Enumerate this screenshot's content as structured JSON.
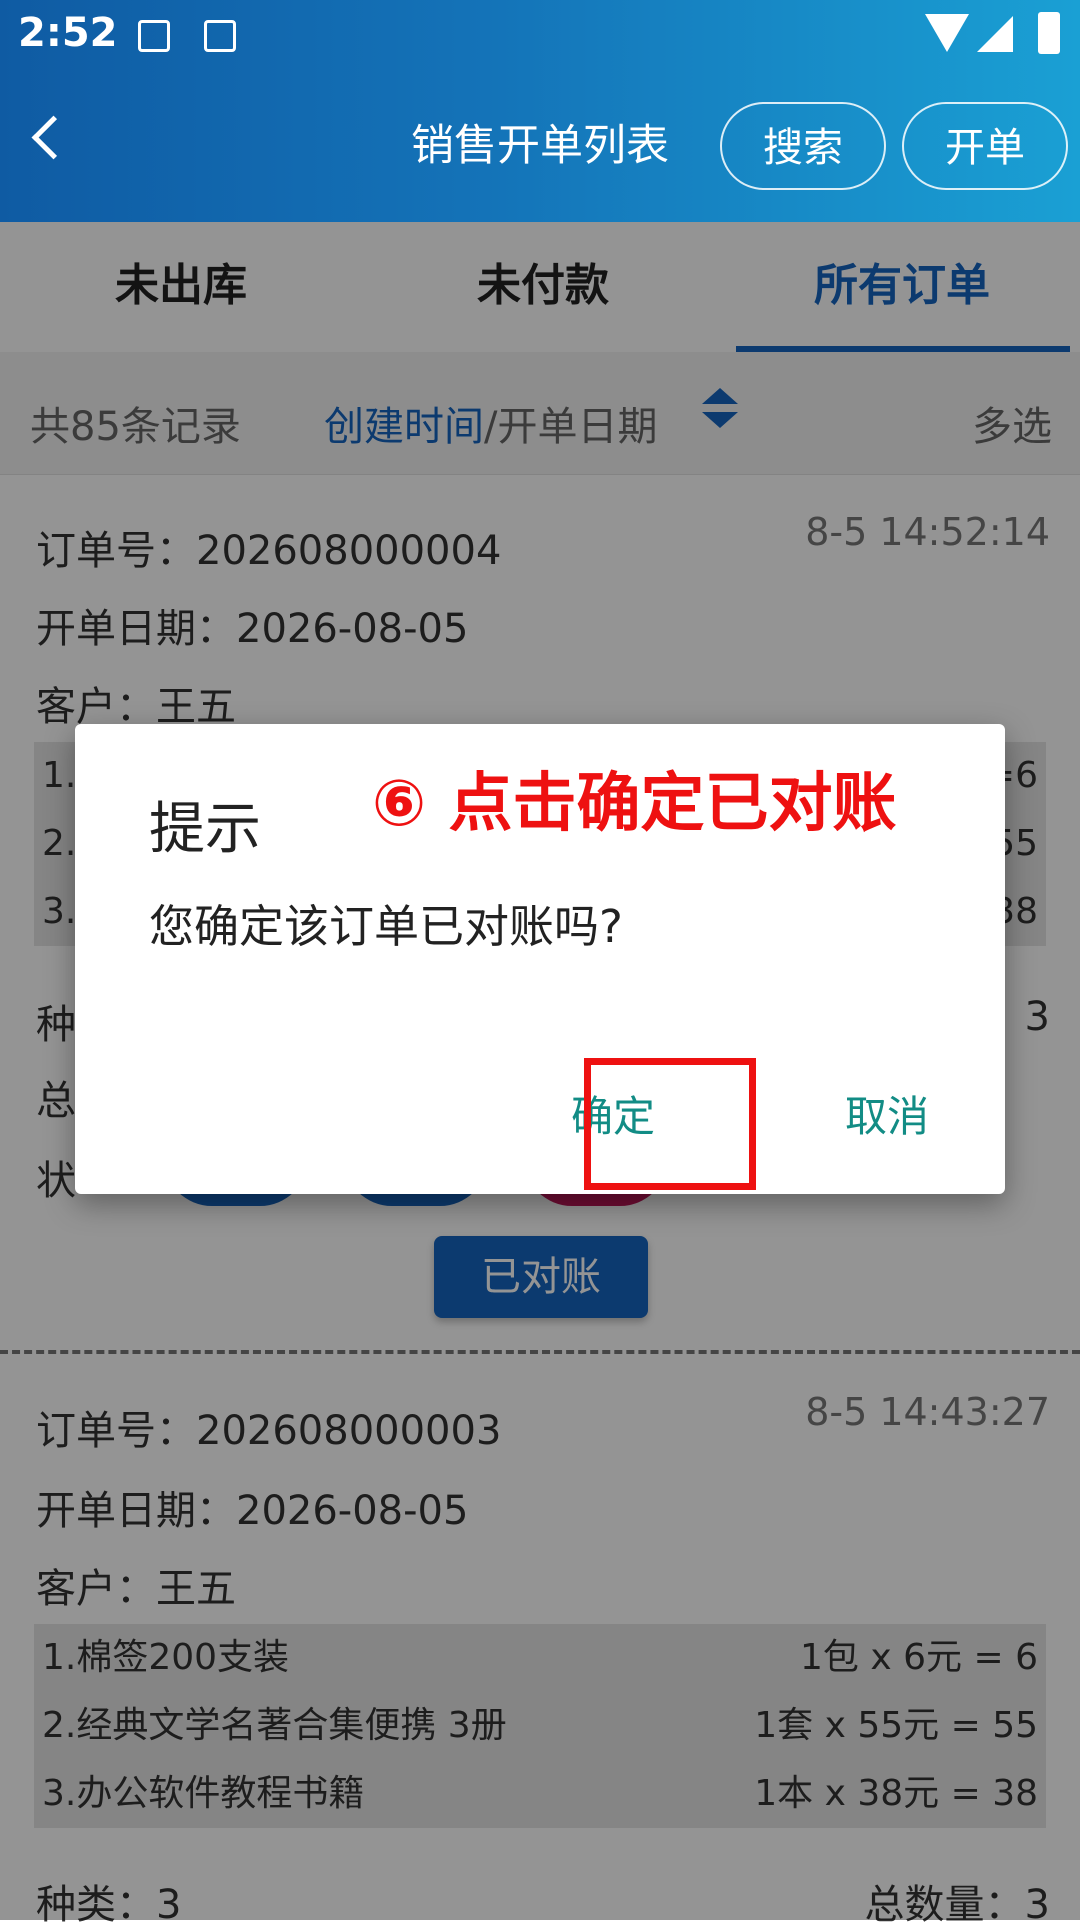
{
  "status_bar": {
    "time": "2:52"
  },
  "header": {
    "title": "销售开单列表",
    "search_label": "搜索",
    "create_label": "开单"
  },
  "tabs": [
    {
      "label": "未出库"
    },
    {
      "label": "未付款"
    },
    {
      "label": "所有订单",
      "active": true
    }
  ],
  "filter": {
    "count": "共85条记录",
    "sort_active": "创建时间",
    "sort_rest": "/开单日期",
    "multi_select": "多选"
  },
  "orders": [
    {
      "order_no": "订单号：202608000004",
      "timestamp": "8-5 14:52:14",
      "date": "开单日期：2026-08-05",
      "customer": "客户：王五",
      "items": [
        {
          "name": "1.",
          "price": "=6"
        },
        {
          "name": "2.",
          "price": "55"
        },
        {
          "name": "3.",
          "price": "38"
        }
      ],
      "kinds_prefix": "种",
      "kinds_value": "3",
      "total_prefix": "总",
      "status_prefix": "状",
      "action_label": "已对账"
    },
    {
      "order_no": "订单号：202608000003",
      "timestamp": "8-5 14:43:27",
      "date": "开单日期：2026-08-05",
      "customer": "客户：王五",
      "items": [
        {
          "name": "1.棉签200支装",
          "price": "1包 x 6元 = 6"
        },
        {
          "name": "2.经典文学名著合集便携 3册",
          "price": "1套 x 55元 = 55"
        },
        {
          "name": "3.办公软件教程书籍",
          "price": "1本 x 38元 = 38"
        }
      ],
      "kinds": "种类：3",
      "total_qty": "总数量：3"
    }
  ],
  "dialog": {
    "title": "提示",
    "message": "您确定该订单已对账吗?",
    "confirm_label": "确定",
    "cancel_label": "取消"
  },
  "annotation": {
    "text": "⑥ 点击确定已对账",
    "color": "#ee1111"
  },
  "colors": {
    "primary": "#1565c0",
    "dialog_button": "#128c85"
  }
}
